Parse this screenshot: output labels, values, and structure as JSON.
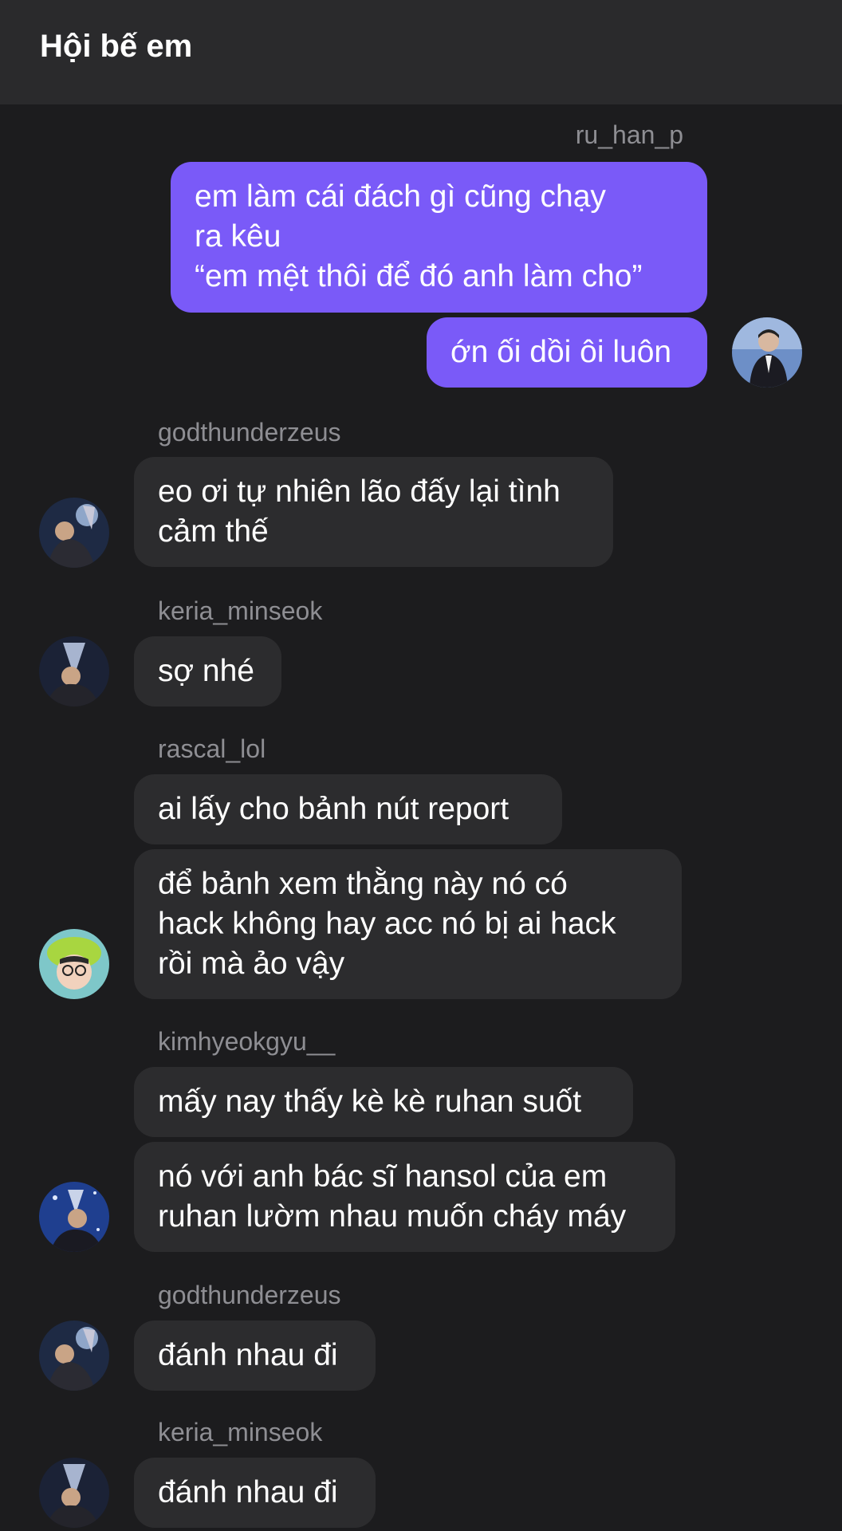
{
  "header": {
    "title": "Hội bế em"
  },
  "messages": [
    {
      "user": "ru_han_p",
      "texts": [
        "em làm cái đách gì cũng chạy\nra kêu\n“em mệt thôi để đó anh làm cho”",
        "ớn ối dồi ôi luôn"
      ]
    },
    {
      "user": "godthunderzeus",
      "texts": [
        "eo ơi tự nhiên lão đấy lại tình\ncảm thế"
      ]
    },
    {
      "user": "keria_minseok",
      "texts": [
        "sợ nhé"
      ]
    },
    {
      "user": "rascal_lol",
      "texts": [
        "ai lấy cho bảnh nút report",
        "để bảnh xem thằng này nó có\nhack không hay acc nó bị ai hack\nrồi mà ảo vậy"
      ]
    },
    {
      "user": "kimhyeokgyu__",
      "texts": [
        "mấy nay thấy kè kè ruhan suốt",
        "nó với anh bác sĩ hansol của em\nruhan lườm nhau muốn cháy máy"
      ]
    },
    {
      "user": "godthunderzeus",
      "texts": [
        "đánh nhau đi"
      ]
    },
    {
      "user": "keria_minseok",
      "texts": [
        "đánh nhau đi"
      ]
    }
  ],
  "colors": {
    "outgoing_bubble": "#7a5af8",
    "incoming_bubble": "#2c2c2e",
    "background": "#1c1c1e"
  }
}
